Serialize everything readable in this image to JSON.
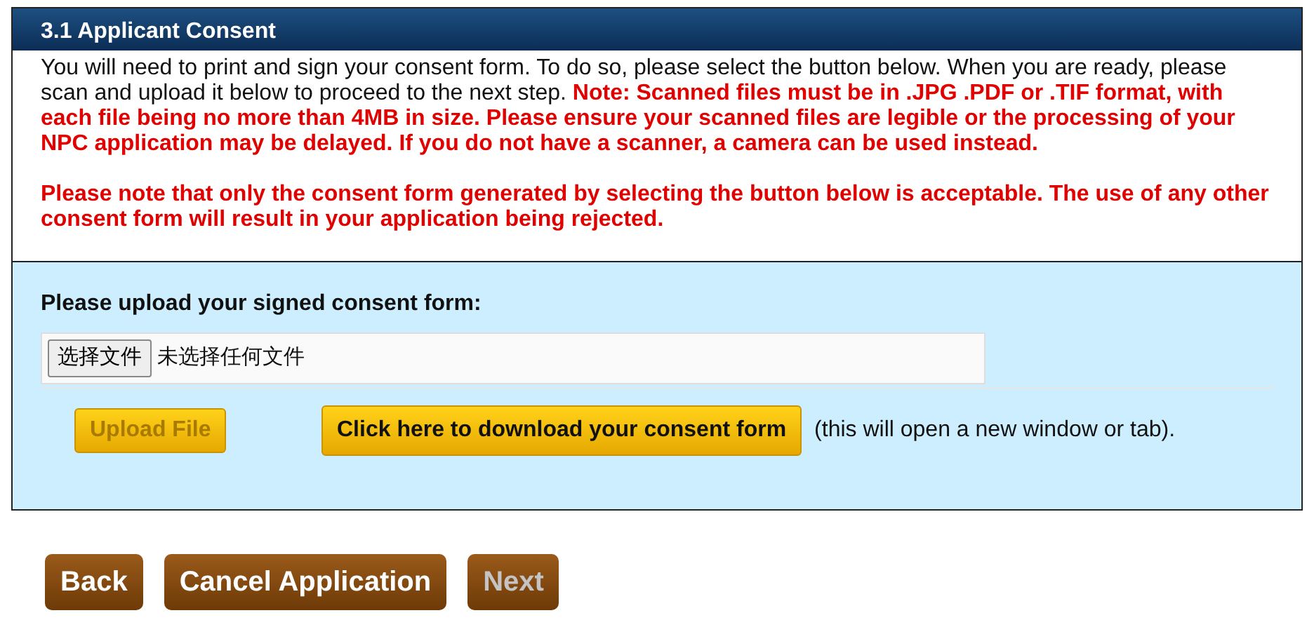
{
  "section": {
    "title": "3.1 Applicant Consent"
  },
  "instructions": "You will need to print and sign your consent form. To do so, please select the button below. When you are ready, please scan and upload it below to proceed to the next step. **Note: Scanned files must be in .JPG .PDF or .TIF format, with each file being no more than 4MB in size. Please ensure your scanned files are legible or the processing of your NPC application may be delayed. If you do not have a scanner, a camera can be used instead.**",
  "warning": "Please note that only the consent form generated by selecting the button below is acceptable. The use of any other consent form will result in your application being rejected.",
  "upload": {
    "label": "Please upload your signed consent form:",
    "choose_button": "选择文件",
    "file_status": "未选择任何文件",
    "upload_button": {
      "label": "Upload File",
      "disabled": true
    },
    "download_button": {
      "label": "Click here to download your consent form"
    },
    "download_note": "(this will open a new window or tab)."
  },
  "footer_buttons": [
    {
      "label": "Back",
      "disabled": false
    },
    {
      "label": "Cancel Application",
      "disabled": false
    },
    {
      "label": "Next",
      "disabled": true
    }
  ]
}
